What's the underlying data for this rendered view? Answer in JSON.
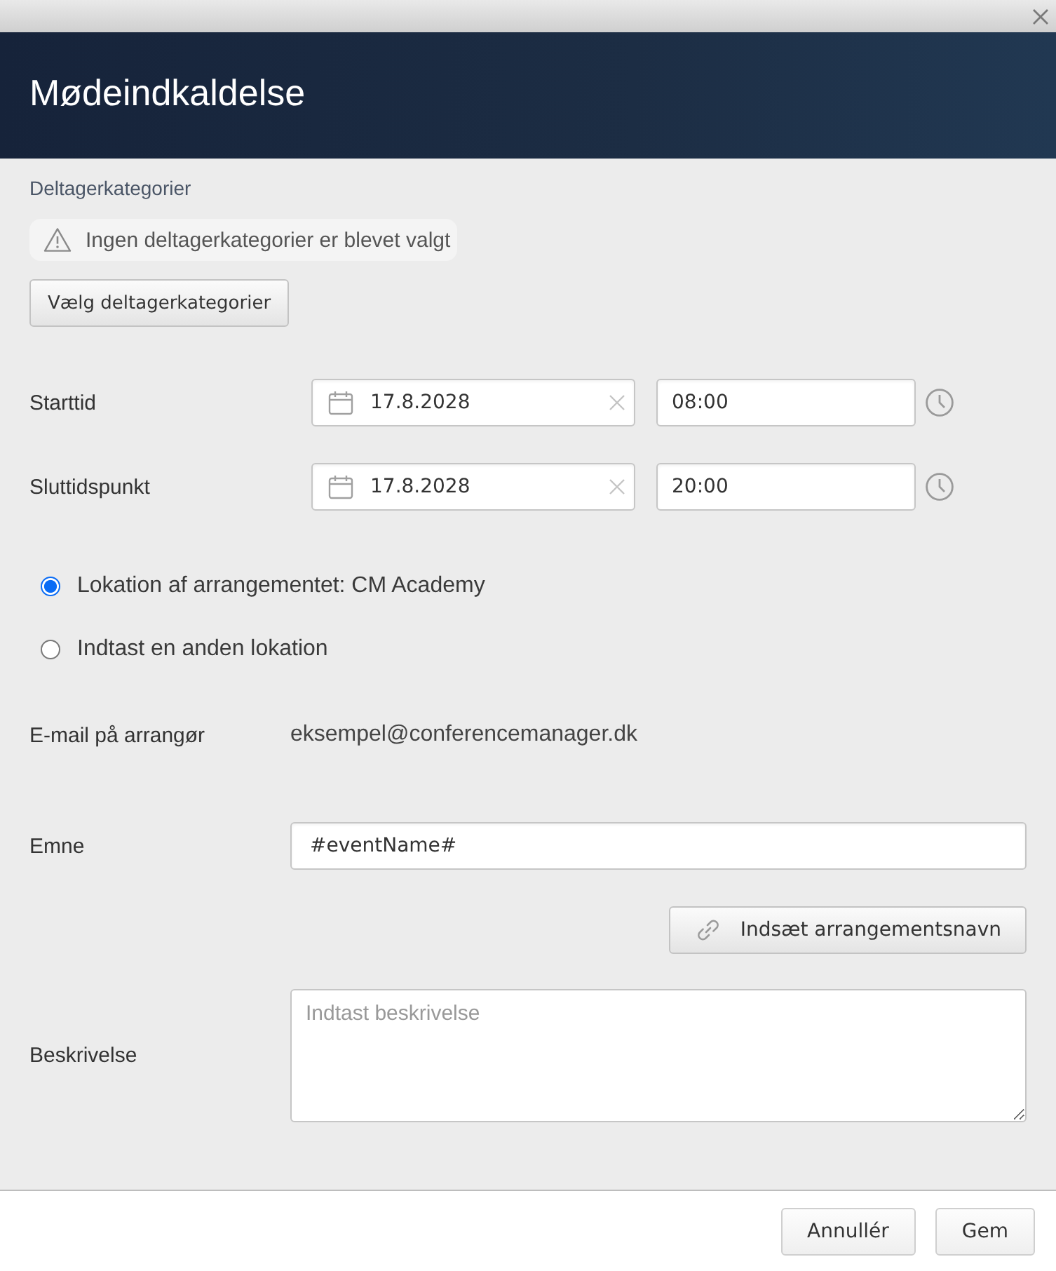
{
  "header": {
    "title": "Mødeindkaldelse"
  },
  "participant_categories": {
    "label": "Deltagerkategorier",
    "warning": "Ingen deltagerkategorier er blevet valgt",
    "button": "Vælg deltagerkategorier"
  },
  "times": [
    {
      "label": "Starttid",
      "date": "17.8.2028",
      "time": "08:00"
    },
    {
      "label": "Sluttidspunkt",
      "date": "17.8.2028",
      "time": "20:00"
    }
  ],
  "location_options": [
    {
      "label": "Lokation af arrangementet: CM Academy",
      "selected": true
    },
    {
      "label": "Indtast en anden lokation",
      "selected": false
    }
  ],
  "organizer_email": {
    "label": "E-mail på arrangør",
    "value": "eksempel@conferencemanager.dk"
  },
  "subject": {
    "label": "Emne",
    "value": "#eventName#",
    "insert_button": "Indsæt arrangementsnavn"
  },
  "description": {
    "label": "Beskrivelse",
    "placeholder": "Indtast beskrivelse"
  },
  "footer_buttons": [
    "Annullér",
    "Gem"
  ]
}
